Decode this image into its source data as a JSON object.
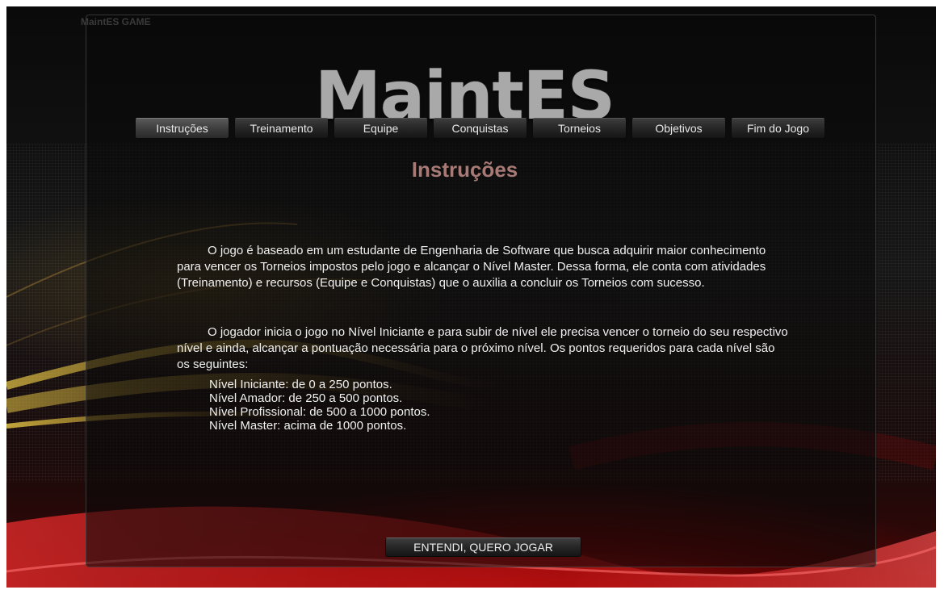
{
  "window": {
    "caption": "MaintES GAME"
  },
  "logo": {
    "text": "MaintES"
  },
  "nav": {
    "items": [
      {
        "label": "Instruções",
        "active": true
      },
      {
        "label": "Treinamento",
        "active": false
      },
      {
        "label": "Equipe",
        "active": false
      },
      {
        "label": "Conquistas",
        "active": false
      },
      {
        "label": "Torneios",
        "active": false
      },
      {
        "label": "Objetivos",
        "active": false
      },
      {
        "label": "Fim do Jogo",
        "active": false
      }
    ]
  },
  "main": {
    "title": "Instruções",
    "paragraphs": [
      "O jogo é baseado em um estudante de Engenharia de Software que busca adquirir maior conhecimento para vencer os Torneios impostos pelo jogo e alcançar o Nível Master. Dessa forma, ele conta com atividades (Treinamento) e recursos (Equipe e Conquistas) que o auxilia a concluir os Torneios com sucesso.",
      "O jogador inicia o jogo no Nível Iniciante e para subir de nível ele precisa vencer o torneio do seu respectivo nível e ainda, alcançar a pontuação necessária para o próximo nível. Os pontos requeridos para cada nível são os seguintes:"
    ],
    "levels": [
      "Nível Iniciante: de 0 a 250 pontos.",
      "Nível Amador: de 250 a 500 pontos.",
      "Nível Profissional: de 500 a 1000 pontos.",
      "Nível Master: acima de 1000 pontos."
    ]
  },
  "footer": {
    "confirm_label": "ENTENDI, QUERO JOGAR"
  },
  "colors": {
    "title": "#a87a75",
    "text": "#f0f0f0",
    "logo": "#a9a9a9",
    "accent_red": "#d21414"
  }
}
